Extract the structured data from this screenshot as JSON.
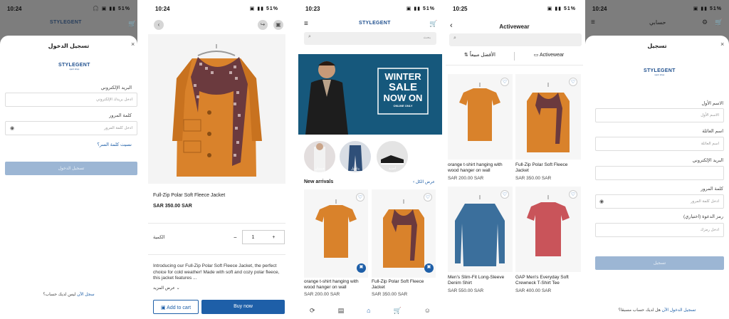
{
  "screen1": {
    "time": "10:24",
    "status_icons": "🎧 ▣ ▮▮ 51%",
    "title": "تسجيل الدخول",
    "close": "×",
    "logo": "STYLEGENT",
    "logo_sub": "sport shop",
    "email_label": "البريد الإلكتروني",
    "email_placeholder": "ادخل بريدك الإلكتروني",
    "password_label": "كلمة المرور",
    "password_placeholder": "ادخل كلمة المرور",
    "forgot": "نسيت كلمة السر؟",
    "login_button": "تسجيل الدخول",
    "signup_prompt": "ليس لديك حساب؟",
    "signup_link": "سجل الآن"
  },
  "screen2": {
    "time": "10:24",
    "status_icons": "▣ ▮▮ 51%",
    "product_title": "Full-Zip Polar Soft Fleece Jacket",
    "price": "SAR 350.00 SAR",
    "qty_label": "الكمية",
    "qty_value": "1",
    "minus": "−",
    "plus": "+",
    "description": "Introducing our Full-Zip Polar Soft Fleece Jacket, the perfect choice for cold weather! Made with soft and cozy polar fleece, this jacket features ...",
    "read_more": "عرض المزيد",
    "add_to_cart": "Add to cart",
    "buy_now": "Buy now"
  },
  "screen3": {
    "time": "10:23",
    "status_icons": "▣ ▮▮ 51%",
    "logo": "STYLEGENT",
    "search_placeholder": "بحث",
    "banner": {
      "line1": "WINTER",
      "line2": "SALE",
      "line3": "NOW ON",
      "line4": "ONLINE ONLY"
    },
    "categories": [
      "قمصان",
      "بناطيل",
      "أحذية"
    ],
    "new_arrivals": "New arrivals",
    "view_all": "عرض الكل",
    "products": [
      {
        "title": "orange t-shirt hanging with wood hanger on wall",
        "price": "SAR 200.00 SAR"
      },
      {
        "title": "Full-Zip Polar Soft Fleece Jacket",
        "price": "SAR 350.00 SAR"
      }
    ]
  },
  "screen4": {
    "time": "10:25",
    "status_icons": "▣ ▮▮ 51%",
    "title": "Activewear",
    "filter_category": "Activewear",
    "filter_sort": "الأفضل مبيعاً",
    "products": [
      {
        "title": "orange t-shirt hanging with wood hanger on wall",
        "price": "SAR 200.00 SAR",
        "color": "#d9822b"
      },
      {
        "title": "Full-Zip Polar Soft Fleece Jacket",
        "price": "SAR 350.00 SAR",
        "color": "#d9822b"
      },
      {
        "title": "Men's Slim-Fit Long-Sleeve Denim Shirt",
        "price": "SAR 550.00 SAR",
        "color": "#3b6f9c"
      },
      {
        "title": "GAP Men's Everyday Soft Crewneck T-Shirt Tee",
        "price": "SAR 400.00 SAR",
        "color": "#c9545a"
      }
    ]
  },
  "screen5": {
    "time": "10:24",
    "status_icons": "▣ ▮▮ 51%",
    "header_title": "حسابي",
    "title": "تسجيل",
    "close": "×",
    "logo": "STYLEGENT",
    "logo_sub": "sport shop",
    "first_name_label": "الاسم الأول",
    "first_name_placeholder": "الاسم الأول",
    "last_name_label": "اسم العائلة",
    "last_name_placeholder": "اسم العائلة",
    "email_label": "البريد الإلكتروني",
    "password_label": "كلمة المرور",
    "password_placeholder": "ادخل كلمة المرور",
    "invite_label": "رمز الدعوة (اختياري)",
    "invite_placeholder": "ادخل رمزك",
    "register_button": "تسجيل",
    "login_prompt": "هل لديك حساب مسبقا؟",
    "login_link": "تسجيل الدخول الآن"
  },
  "colors": {
    "accent": "#1e5fa8",
    "overlay": "#7d7d7d",
    "orange": "#d9822b"
  }
}
